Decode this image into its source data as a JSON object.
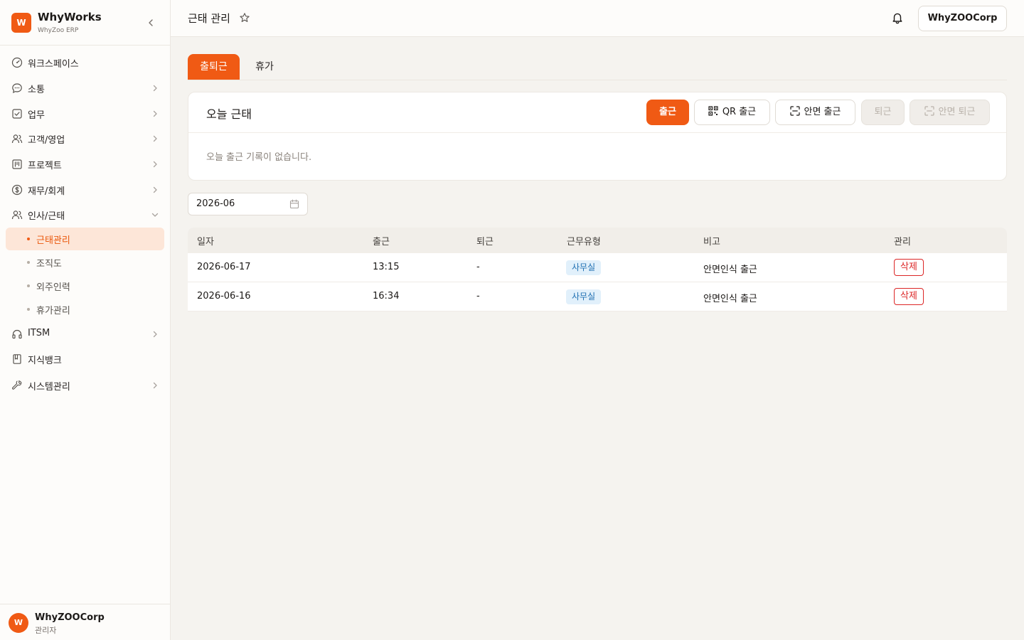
{
  "brand": {
    "logo_letter": "W",
    "name": "WhyWorks",
    "subtitle": "WhyZoo ERP"
  },
  "sidebar": {
    "items": [
      {
        "label": "워크스페이스",
        "icon": "gauge-icon"
      },
      {
        "label": "소통",
        "icon": "message-icon"
      },
      {
        "label": "업무",
        "icon": "checkbox-icon"
      },
      {
        "label": "고객/영업",
        "icon": "users-icon"
      },
      {
        "label": "프로젝트",
        "icon": "kanban-icon"
      },
      {
        "label": "재무/회계",
        "icon": "dollar-icon"
      },
      {
        "label": "인사/근태",
        "icon": "people-icon",
        "expanded": true
      },
      {
        "label": "ITSM",
        "icon": "headset-icon"
      },
      {
        "label": "지식뱅크",
        "icon": "book-icon"
      },
      {
        "label": "시스템관리",
        "icon": "wrench-icon"
      }
    ],
    "sub_items": [
      {
        "label": "근태관리",
        "active": true
      },
      {
        "label": "조직도"
      },
      {
        "label": "외주인력"
      },
      {
        "label": "휴가관리"
      }
    ]
  },
  "user": {
    "avatar_letter": "W",
    "name": "WhyZOOCorp",
    "role": "관리자"
  },
  "header": {
    "title": "근태 관리",
    "org_button": "WhyZOOCorp"
  },
  "tabs": [
    {
      "label": "출퇴근",
      "active": true
    },
    {
      "label": "휴가"
    }
  ],
  "today_card": {
    "title": "오늘 근태",
    "empty_message": "오늘 출근 기록이 없습니다.",
    "buttons": {
      "check_in": "출근",
      "qr_check_in": "QR 출근",
      "face_check_in": "안면 출근",
      "check_out": "퇴근",
      "face_check_out": "안면 퇴근"
    }
  },
  "filter": {
    "month": "2026-06"
  },
  "table": {
    "columns": [
      "일자",
      "출근",
      "퇴근",
      "근무유형",
      "비고",
      "관리"
    ],
    "rows": [
      {
        "date": "2026-06-17",
        "in": "13:15",
        "out": "-",
        "type": "사무실",
        "note": "안면인식 출근",
        "action": "삭제"
      },
      {
        "date": "2026-06-16",
        "in": "16:34",
        "out": "-",
        "type": "사무실",
        "note": "안면인식 출근",
        "action": "삭제"
      }
    ]
  },
  "colors": {
    "accent": "#f05a14",
    "danger": "#dc2626",
    "badge_bg": "#e1f0fb",
    "badge_text": "#1f6fb2"
  }
}
